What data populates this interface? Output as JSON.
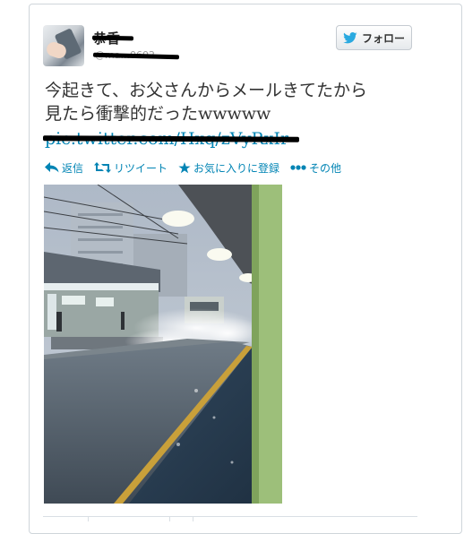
{
  "tweet": {
    "author_name": "恭香",
    "author_handle": "@ma...0602",
    "text_lines": [
      "今起きて、お父さんからメールきてたから",
      "見たら衝撃的だったwwwww"
    ],
    "link_text": "pic.twitter.com/Hxq/zVyRxIr",
    "follow_label": "フォロー"
  },
  "actions": [
    {
      "label": "返信",
      "icon": "reply-icon"
    },
    {
      "label": "リツイート",
      "icon": "retweet-icon"
    },
    {
      "label": "お気に入りに登録",
      "icon": "star-icon"
    },
    {
      "label": "その他",
      "icon": "more-icon"
    }
  ],
  "colors": {
    "link": "#0084b4",
    "twitter_blue": "#2aa9e0",
    "text": "#333333"
  }
}
